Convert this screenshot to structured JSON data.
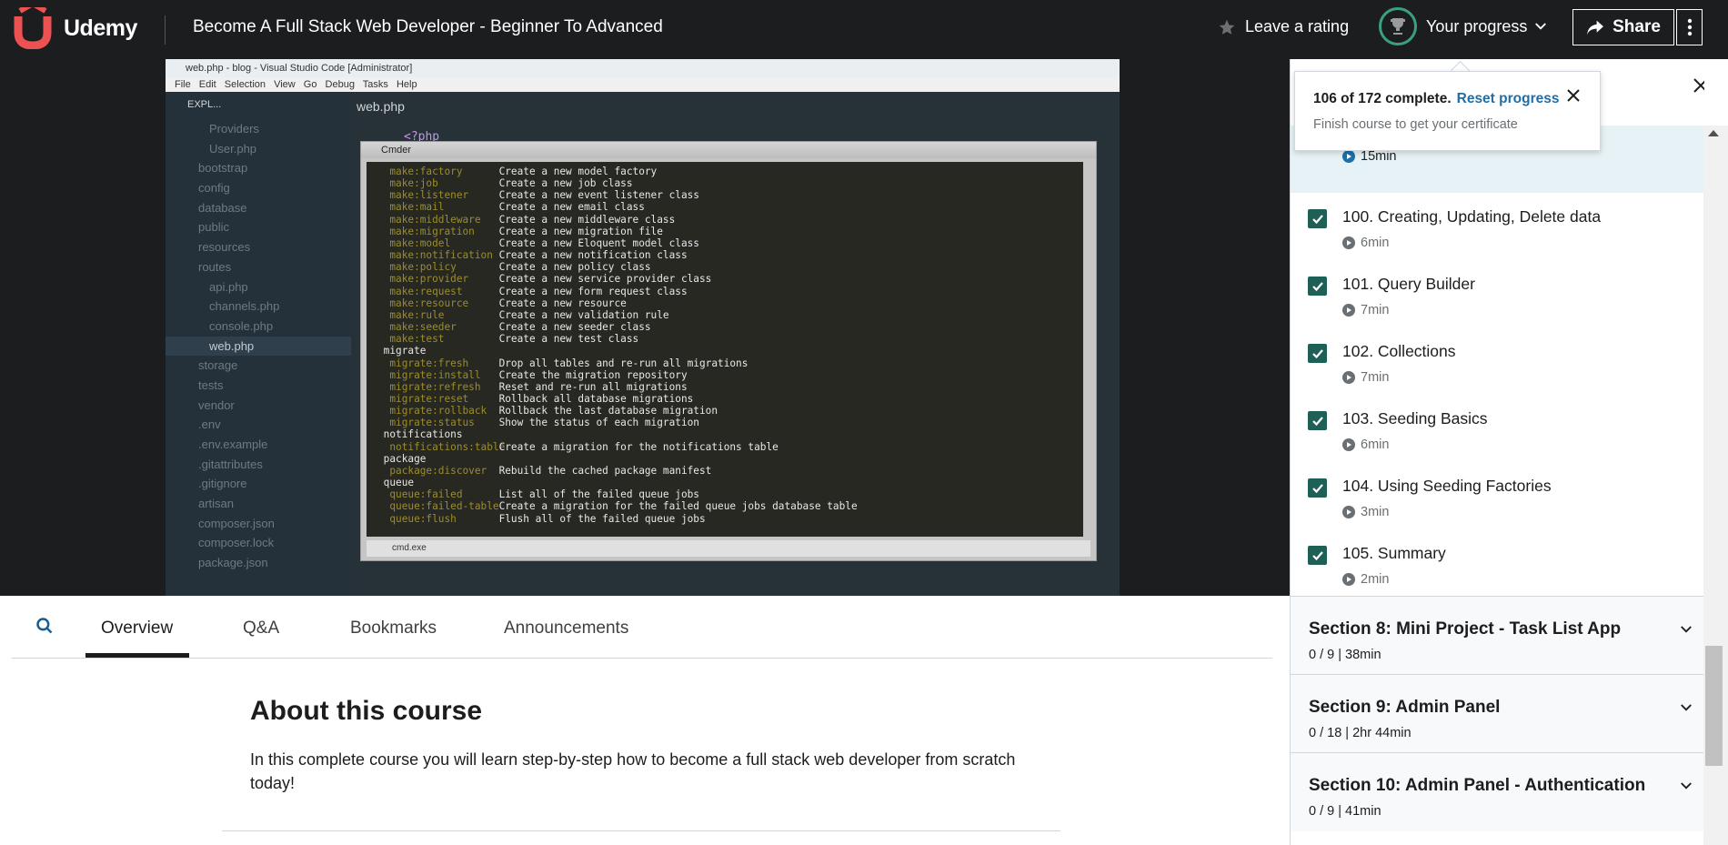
{
  "header": {
    "brand": "Udemy",
    "course_title": "Become A Full Stack Web Developer - Beginner To Advanced",
    "rating_label": "Leave a rating",
    "progress_label": "Your progress",
    "share_label": "Share"
  },
  "progress_popup": {
    "complete_text": "106 of 172 complete.",
    "reset_label": "Reset progress",
    "certificate_text": "Finish course to get your certificate"
  },
  "video": {
    "window_title": "web.php - blog - Visual Studio Code [Administrator]",
    "menu": "File  Edit  Selection  View  Go  Debug  Tasks  Help",
    "explorer_label": "EXPL...",
    "editor_tab": "web.php",
    "php_tag": "<?php",
    "file_tree": [
      {
        "name": "Providers",
        "indent": true
      },
      {
        "name": "User.php",
        "indent": true
      },
      {
        "name": "bootstrap",
        "indent": false
      },
      {
        "name": "config",
        "indent": false
      },
      {
        "name": "database",
        "indent": false
      },
      {
        "name": "public",
        "indent": false
      },
      {
        "name": "resources",
        "indent": false
      },
      {
        "name": "routes",
        "indent": false
      },
      {
        "name": "api.php",
        "indent": true
      },
      {
        "name": "channels.php",
        "indent": true
      },
      {
        "name": "console.php",
        "indent": true
      },
      {
        "name": "web.php",
        "indent": true,
        "active": true
      },
      {
        "name": "storage",
        "indent": false
      },
      {
        "name": "tests",
        "indent": false
      },
      {
        "name": "vendor",
        "indent": false
      },
      {
        "name": ".env",
        "indent": false
      },
      {
        "name": ".env.example",
        "indent": false
      },
      {
        "name": ".gitattributes",
        "indent": false
      },
      {
        "name": ".gitignore",
        "indent": false
      },
      {
        "name": "artisan",
        "indent": false
      },
      {
        "name": "composer.json",
        "indent": false
      },
      {
        "name": "composer.lock",
        "indent": false
      },
      {
        "name": "package.json",
        "indent": false
      }
    ],
    "terminal_title": "Cmder",
    "terminal_footer": "cmd.exe",
    "terminal_lines": [
      {
        "cmd": "  make:factory",
        "desc": "Create a new model factory"
      },
      {
        "cmd": "  make:job",
        "desc": "Create a new job class"
      },
      {
        "cmd": "  make:listener",
        "desc": "Create a new event listener class"
      },
      {
        "cmd": "  make:mail",
        "desc": "Create a new email class"
      },
      {
        "cmd": "  make:middleware",
        "desc": "Create a new middleware class"
      },
      {
        "cmd": "  make:migration",
        "desc": "Create a new migration file"
      },
      {
        "cmd": "  make:model",
        "desc": "Create a new Eloquent model class"
      },
      {
        "cmd": "  make:notification",
        "desc": "Create a new notification class"
      },
      {
        "cmd": "  make:policy",
        "desc": "Create a new policy class"
      },
      {
        "cmd": "  make:provider",
        "desc": "Create a new service provider class"
      },
      {
        "cmd": "  make:request",
        "desc": "Create a new form request class"
      },
      {
        "cmd": "  make:resource",
        "desc": "Create a new resource"
      },
      {
        "cmd": "  make:rule",
        "desc": "Create a new validation rule"
      },
      {
        "cmd": "  make:seeder",
        "desc": "Create a new seeder class"
      },
      {
        "cmd": "  make:test",
        "desc": "Create a new test class"
      },
      {
        "group": " migrate"
      },
      {
        "cmd": "  migrate:fresh",
        "desc": "Drop all tables and re-run all migrations"
      },
      {
        "cmd": "  migrate:install",
        "desc": "Create the migration repository"
      },
      {
        "cmd": "  migrate:refresh",
        "desc": "Reset and re-run all migrations"
      },
      {
        "cmd": "  migrate:reset",
        "desc": "Rollback all database migrations"
      },
      {
        "cmd": "  migrate:rollback",
        "desc": "Rollback the last database migration"
      },
      {
        "cmd": "  migrate:status",
        "desc": "Show the status of each migration"
      },
      {
        "group": " notifications"
      },
      {
        "cmd": "  notifications:table",
        "desc": "Create a migration for the notifications table"
      },
      {
        "group": " package"
      },
      {
        "cmd": "  package:discover",
        "desc": "Rebuild the cached package manifest"
      },
      {
        "group": " queue"
      },
      {
        "cmd": "  queue:failed",
        "desc": "List all of the failed queue jobs"
      },
      {
        "cmd": "  queue:failed-table",
        "desc": "Create a migration for the failed queue jobs database table"
      },
      {
        "cmd": "  queue:flush",
        "desc": "Flush all of the failed queue jobs"
      }
    ]
  },
  "tabs": [
    {
      "label": "Overview",
      "active": true
    },
    {
      "label": "Q&A",
      "active": false
    },
    {
      "label": "Bookmarks",
      "active": false
    },
    {
      "label": "Announcements",
      "active": false
    }
  ],
  "about": {
    "title": "About this course",
    "text": "In this complete course you will learn step-by-step how to become a full stack web developer from scratch today!"
  },
  "sidebar": {
    "current_lesson_duration": "15min",
    "lessons": [
      {
        "title": "100. Creating, Updating, Delete data",
        "duration": "6min",
        "completed": true
      },
      {
        "title": "101. Query Builder",
        "duration": "7min",
        "completed": true
      },
      {
        "title": "102. Collections",
        "duration": "7min",
        "completed": true
      },
      {
        "title": "103. Seeding Basics",
        "duration": "6min",
        "completed": true
      },
      {
        "title": "104. Using Seeding Factories",
        "duration": "3min",
        "completed": true
      },
      {
        "title": "105. Summary",
        "duration": "2min",
        "completed": true
      }
    ],
    "sections": [
      {
        "title": "Section 8: Mini Project - Task List App",
        "meta": "0 / 9 | 38min"
      },
      {
        "title": "Section 9: Admin Panel",
        "meta": "0 / 18 | 2hr 44min"
      },
      {
        "title": "Section 10: Admin Panel - Authentication",
        "meta": "0 / 9 | 41min"
      }
    ]
  },
  "colors": {
    "accent_green": "#1e6055",
    "link_blue": "#1f6ea8",
    "header_bg": "#1c1d1f",
    "progress_ring": "#3aa083"
  }
}
